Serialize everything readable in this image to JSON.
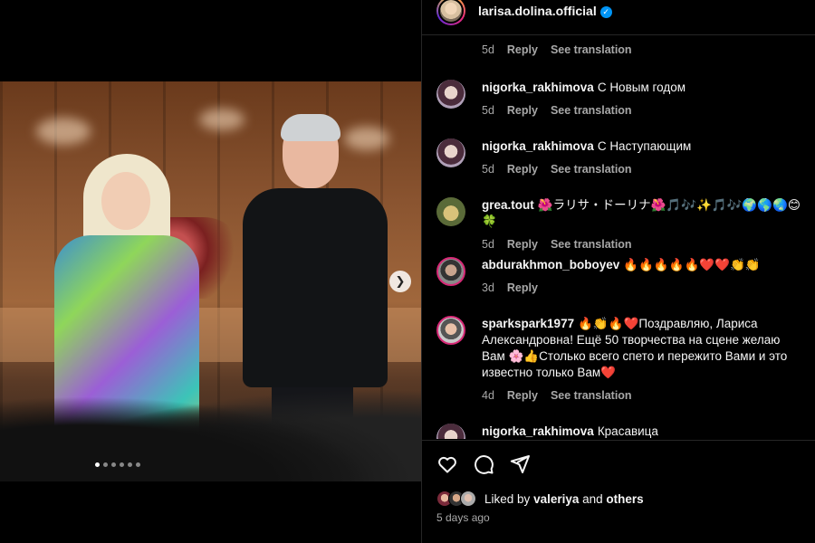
{
  "post": {
    "username": "larisa.dolina.official",
    "verified_icon": "verified-badge-icon",
    "accent": "#0095f6"
  },
  "media": {
    "next_icon": "chevron-right-icon",
    "slide_count": 6,
    "active_slide": 1
  },
  "comments": {
    "cropped": {
      "time": "5d",
      "reply": "Reply",
      "translate": "See translation"
    },
    "items": [
      {
        "user": "nigorka_rakhimova",
        "text": "С Новым годом",
        "time": "5d",
        "reply": "Reply",
        "translate": "See translation"
      },
      {
        "user": "nigorka_rakhimova",
        "text": "С Наступающим",
        "time": "5d",
        "reply": "Reply",
        "translate": "See translation"
      },
      {
        "user": "grea.tout",
        "text": "🌺ラリサ・ドーリナ🌺🎵🎶✨🎵🎶🌍🌎🌏😊🍀",
        "time": "5d",
        "reply": "Reply",
        "translate": "See translation"
      },
      {
        "user": "abdurakhmon_boboyev",
        "text": "🔥🔥🔥🔥🔥❤️❤️👏👏",
        "time": "3d",
        "reply": "Reply"
      },
      {
        "user": "sparkspark1977",
        "text": "🔥👏🔥❤️Поздравляю, Лариса Александровна! Ещё 50 творчества на сцене желаю Вам 🌸👍Столько всего спето и пережито Вами и это известно только Вам❤️",
        "time": "4d",
        "reply": "Reply",
        "translate": "See translation"
      },
      {
        "user": "nigorka_rakhimova",
        "text": "Красавица"
      }
    ]
  },
  "actions": {
    "like_icon": "heart-icon",
    "comment_icon": "comment-icon",
    "share_icon": "send-icon",
    "liked_by_prefix": "Liked by",
    "liked_by_user": "valeriya",
    "liked_by_and": "and",
    "liked_by_others": "others",
    "time_ago": "5 days ago"
  }
}
